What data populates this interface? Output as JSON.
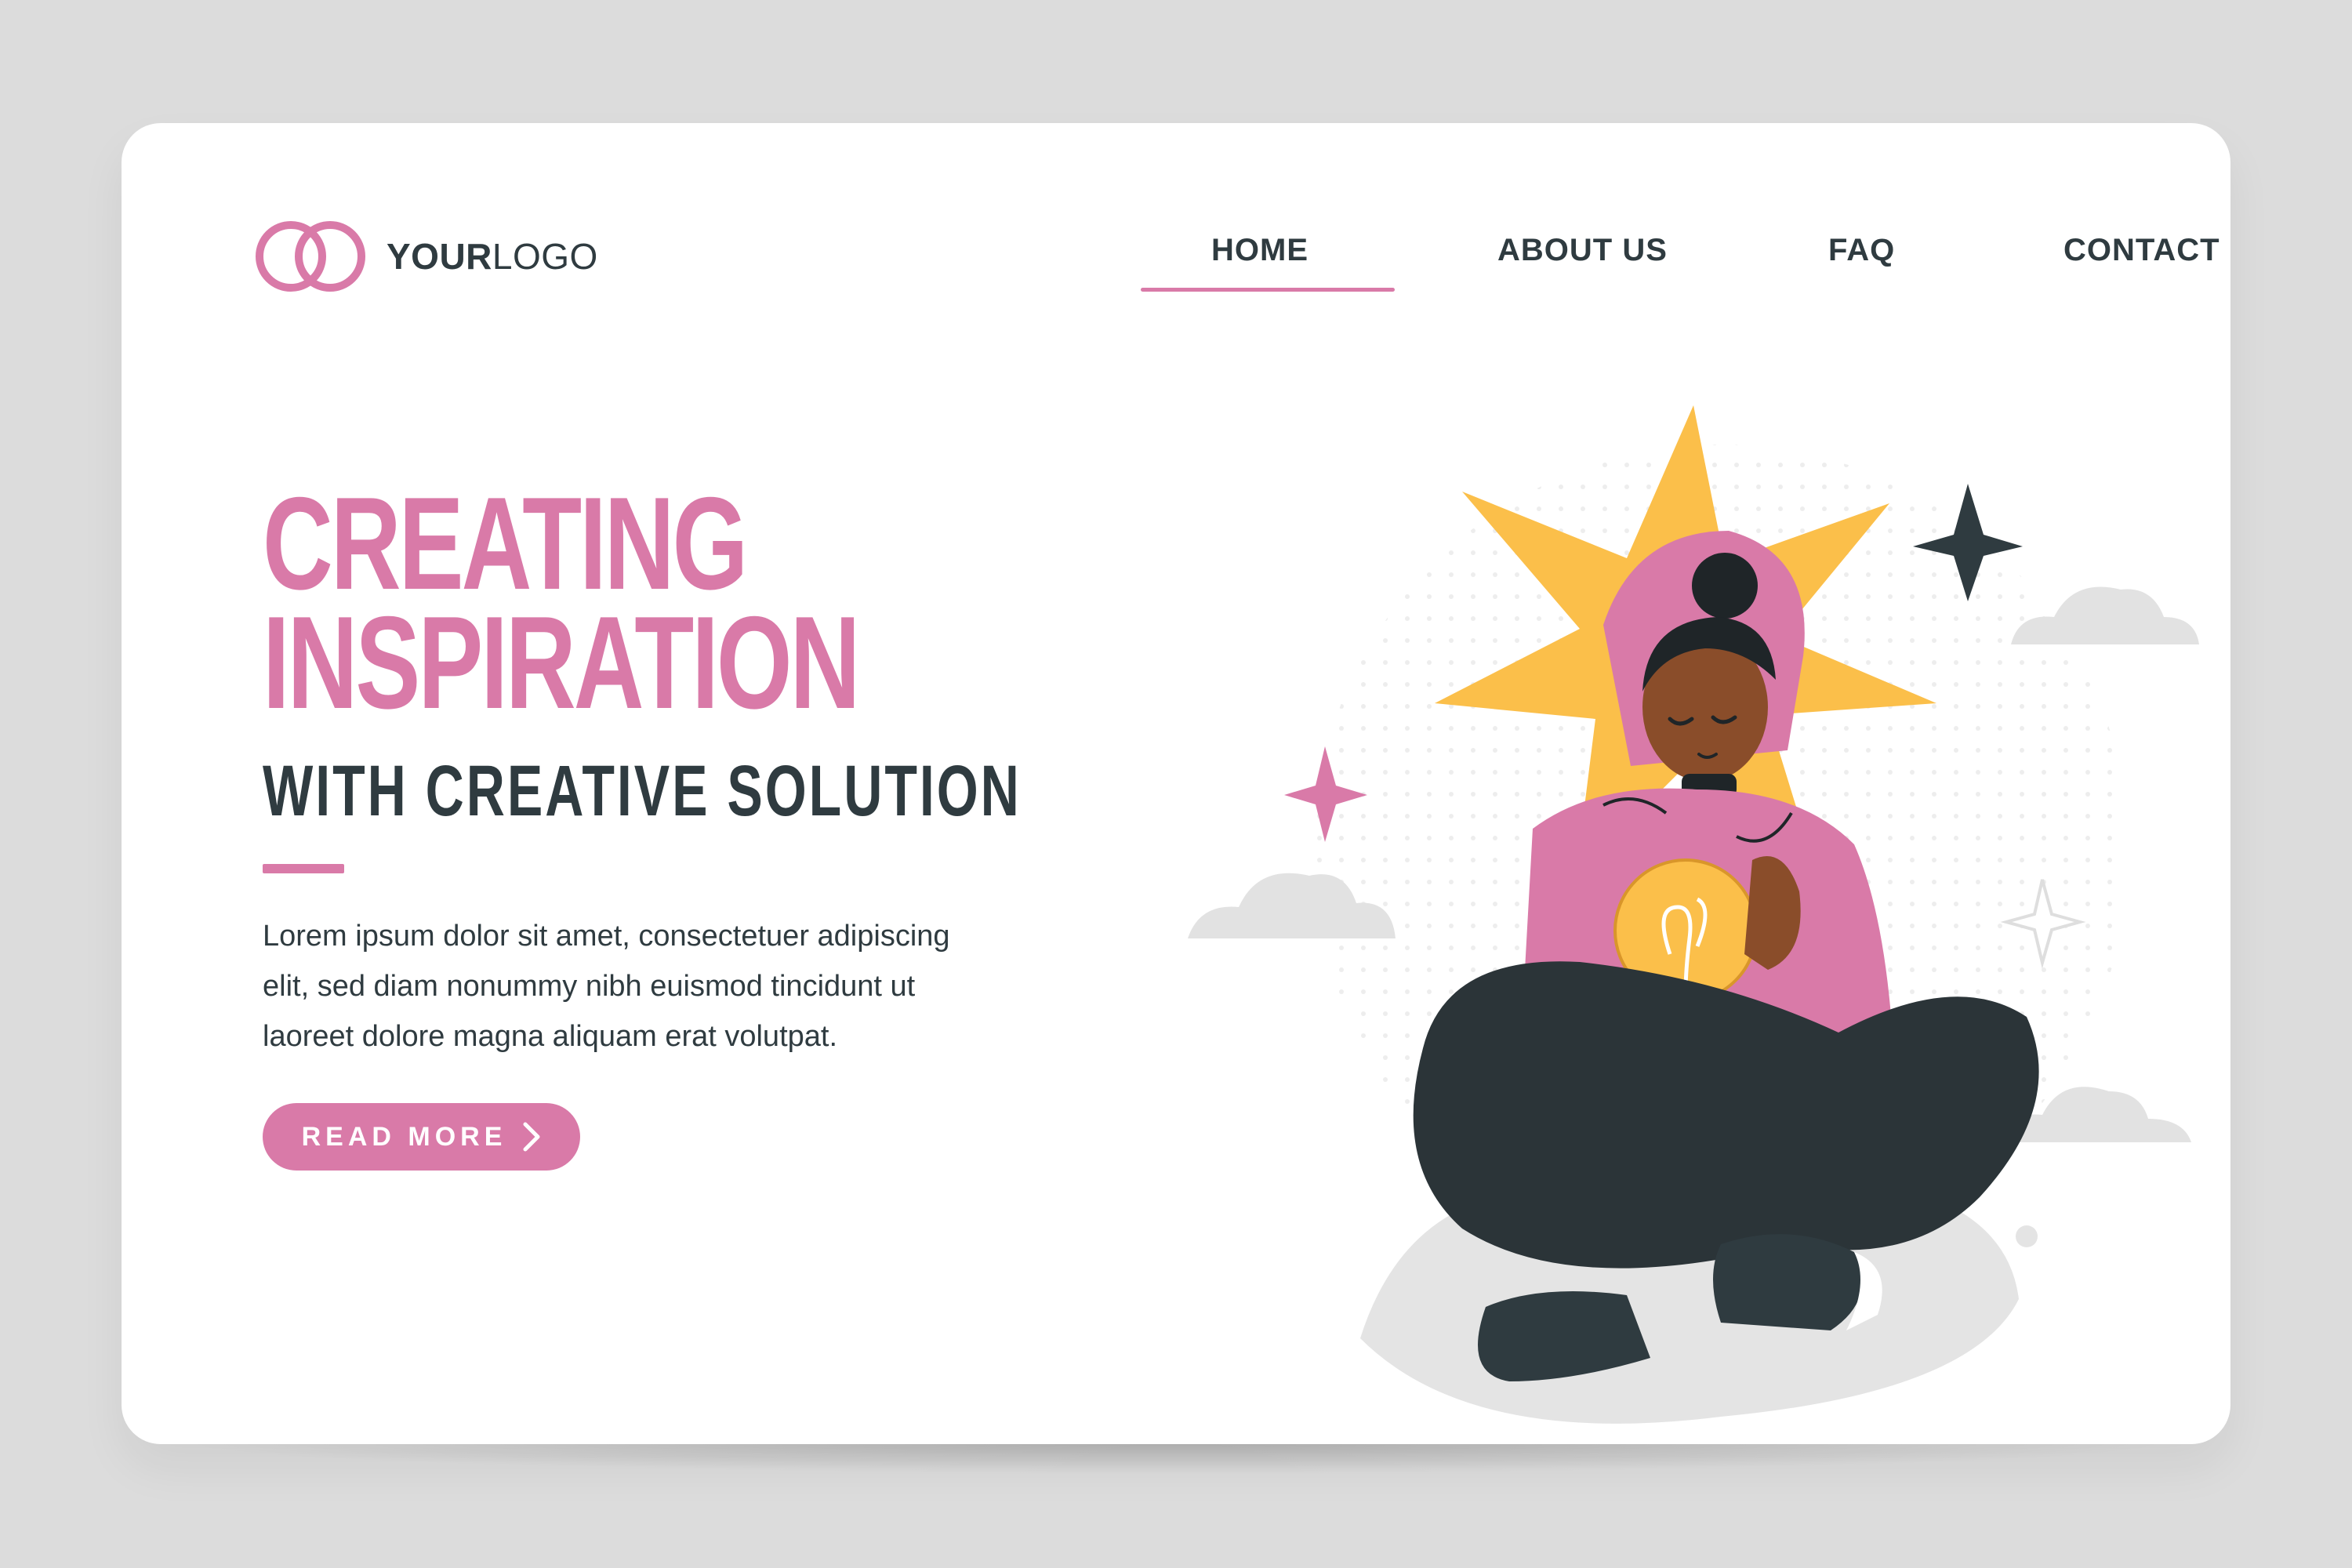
{
  "logo": {
    "bold": "YOUR",
    "light": "LOGO"
  },
  "nav": {
    "items": [
      {
        "label": "HOME",
        "active": true
      },
      {
        "label": "ABOUT US",
        "active": false
      },
      {
        "label": "FAQ",
        "active": false
      },
      {
        "label": "CONTACT",
        "active": false
      }
    ]
  },
  "hero": {
    "title_line1": "CREATING",
    "title_line2": "INSPIRATION",
    "subtitle": "WITH CREATIVE SOLUTION",
    "body_line1": "Lorem ipsum dolor sit amet, consectetuer adipiscing",
    "body_line2": "elit, sed diam nonummy nibh euismod tincidunt ut",
    "body_line3": "laoreet dolore magna aliquam erat volutpat.",
    "cta_label": "READ MORE"
  },
  "colors": {
    "accent": "#d97aa8",
    "text": "#2f3b40",
    "background": "#dcdcdc",
    "card": "#ffffff",
    "star": "#fbbf4a"
  },
  "icons": {
    "logo": "interlocking-rings-icon",
    "cta": "chevron-right-icon"
  },
  "illustration": "person-holding-lightbulb"
}
